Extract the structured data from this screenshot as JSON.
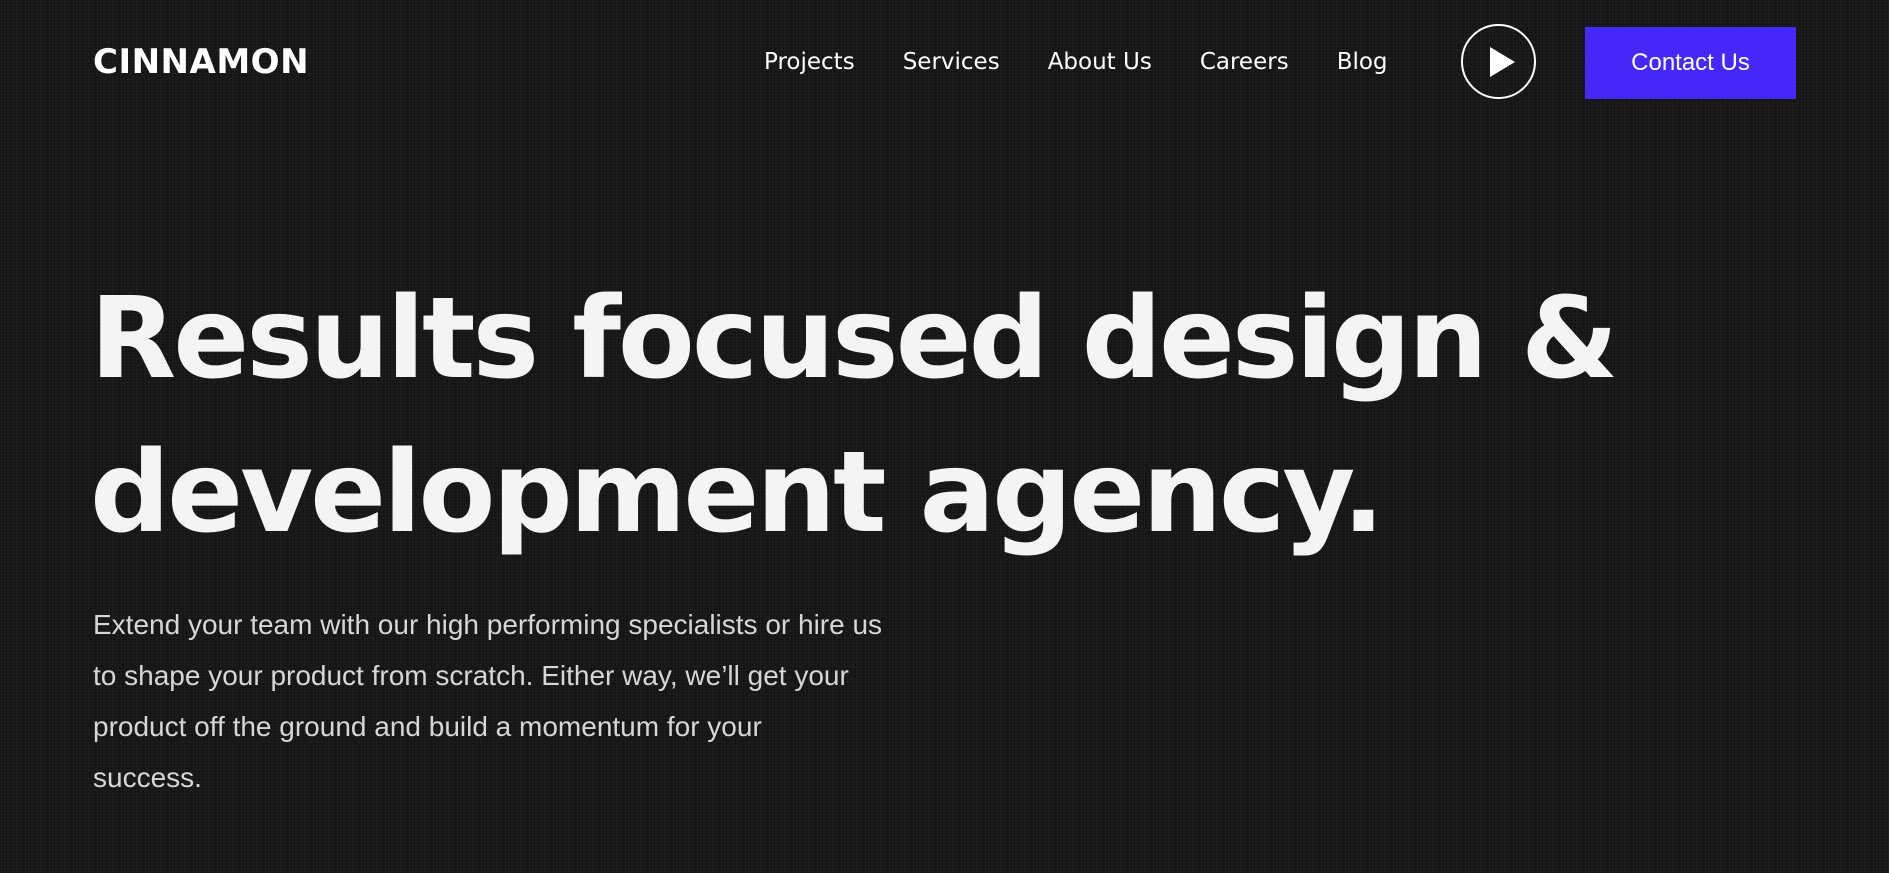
{
  "header": {
    "logo": "CINNAMON",
    "nav": [
      "Projects",
      "Services",
      "About Us",
      "Careers",
      "Blog"
    ],
    "play_icon": "play-icon",
    "contact_label": "Contact Us",
    "accent_color": "#4529fa"
  },
  "hero": {
    "title_line_1": "Results focused design &",
    "title_line_2": "development agency.",
    "body_line_1": "Extend your team with our high performing specialists or hire us",
    "body_line_2": "to shape your product from scratch. Either way, we’ll get your",
    "body_line_3": "product off the ground and build a momentum for your",
    "body_line_4": "success."
  }
}
